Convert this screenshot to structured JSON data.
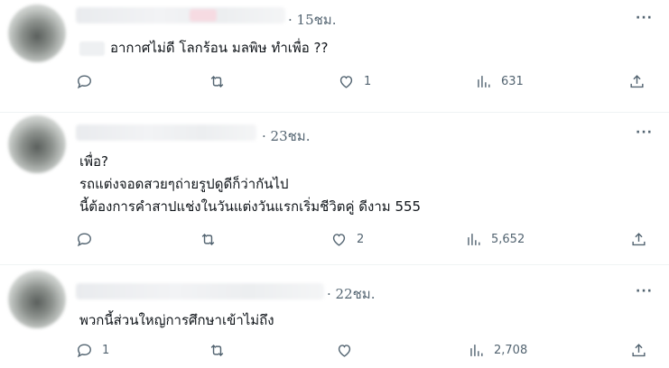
{
  "tweets": [
    {
      "time": "· 15ชม.",
      "lines": [
        "อากาศไม่ดี โลกร้อน มลพิษ ทำเพื่อ ??"
      ],
      "actions": {
        "replies": "",
        "retweets": "",
        "likes": "1",
        "views": "631"
      }
    },
    {
      "time": "· 23ชม.",
      "lines": [
        "เพื่อ?",
        "รถแต่งจอดสวยๆถ่ายรูปดูดีก็ว่ากันไป",
        "นี้ต้องการคำสาปแช่งในวันแต่งวันแรกเริ่มชีวิตคู่ ดีงาม 555"
      ],
      "actions": {
        "replies": "",
        "retweets": "",
        "likes": "2",
        "views": "5,652"
      }
    },
    {
      "time": "· 22ชม.",
      "lines": [
        "พวกนี้ส่วนใหญ่การศึกษาเข้าไม่ถึง"
      ],
      "actions": {
        "replies": "1",
        "retweets": "",
        "likes": "",
        "views": "2,708"
      }
    }
  ],
  "more_label": "···",
  "icons": {
    "reply": "reply-icon",
    "retweet": "retweet-icon",
    "like": "heart-icon",
    "views": "analytics-icon",
    "share": "share-icon"
  }
}
